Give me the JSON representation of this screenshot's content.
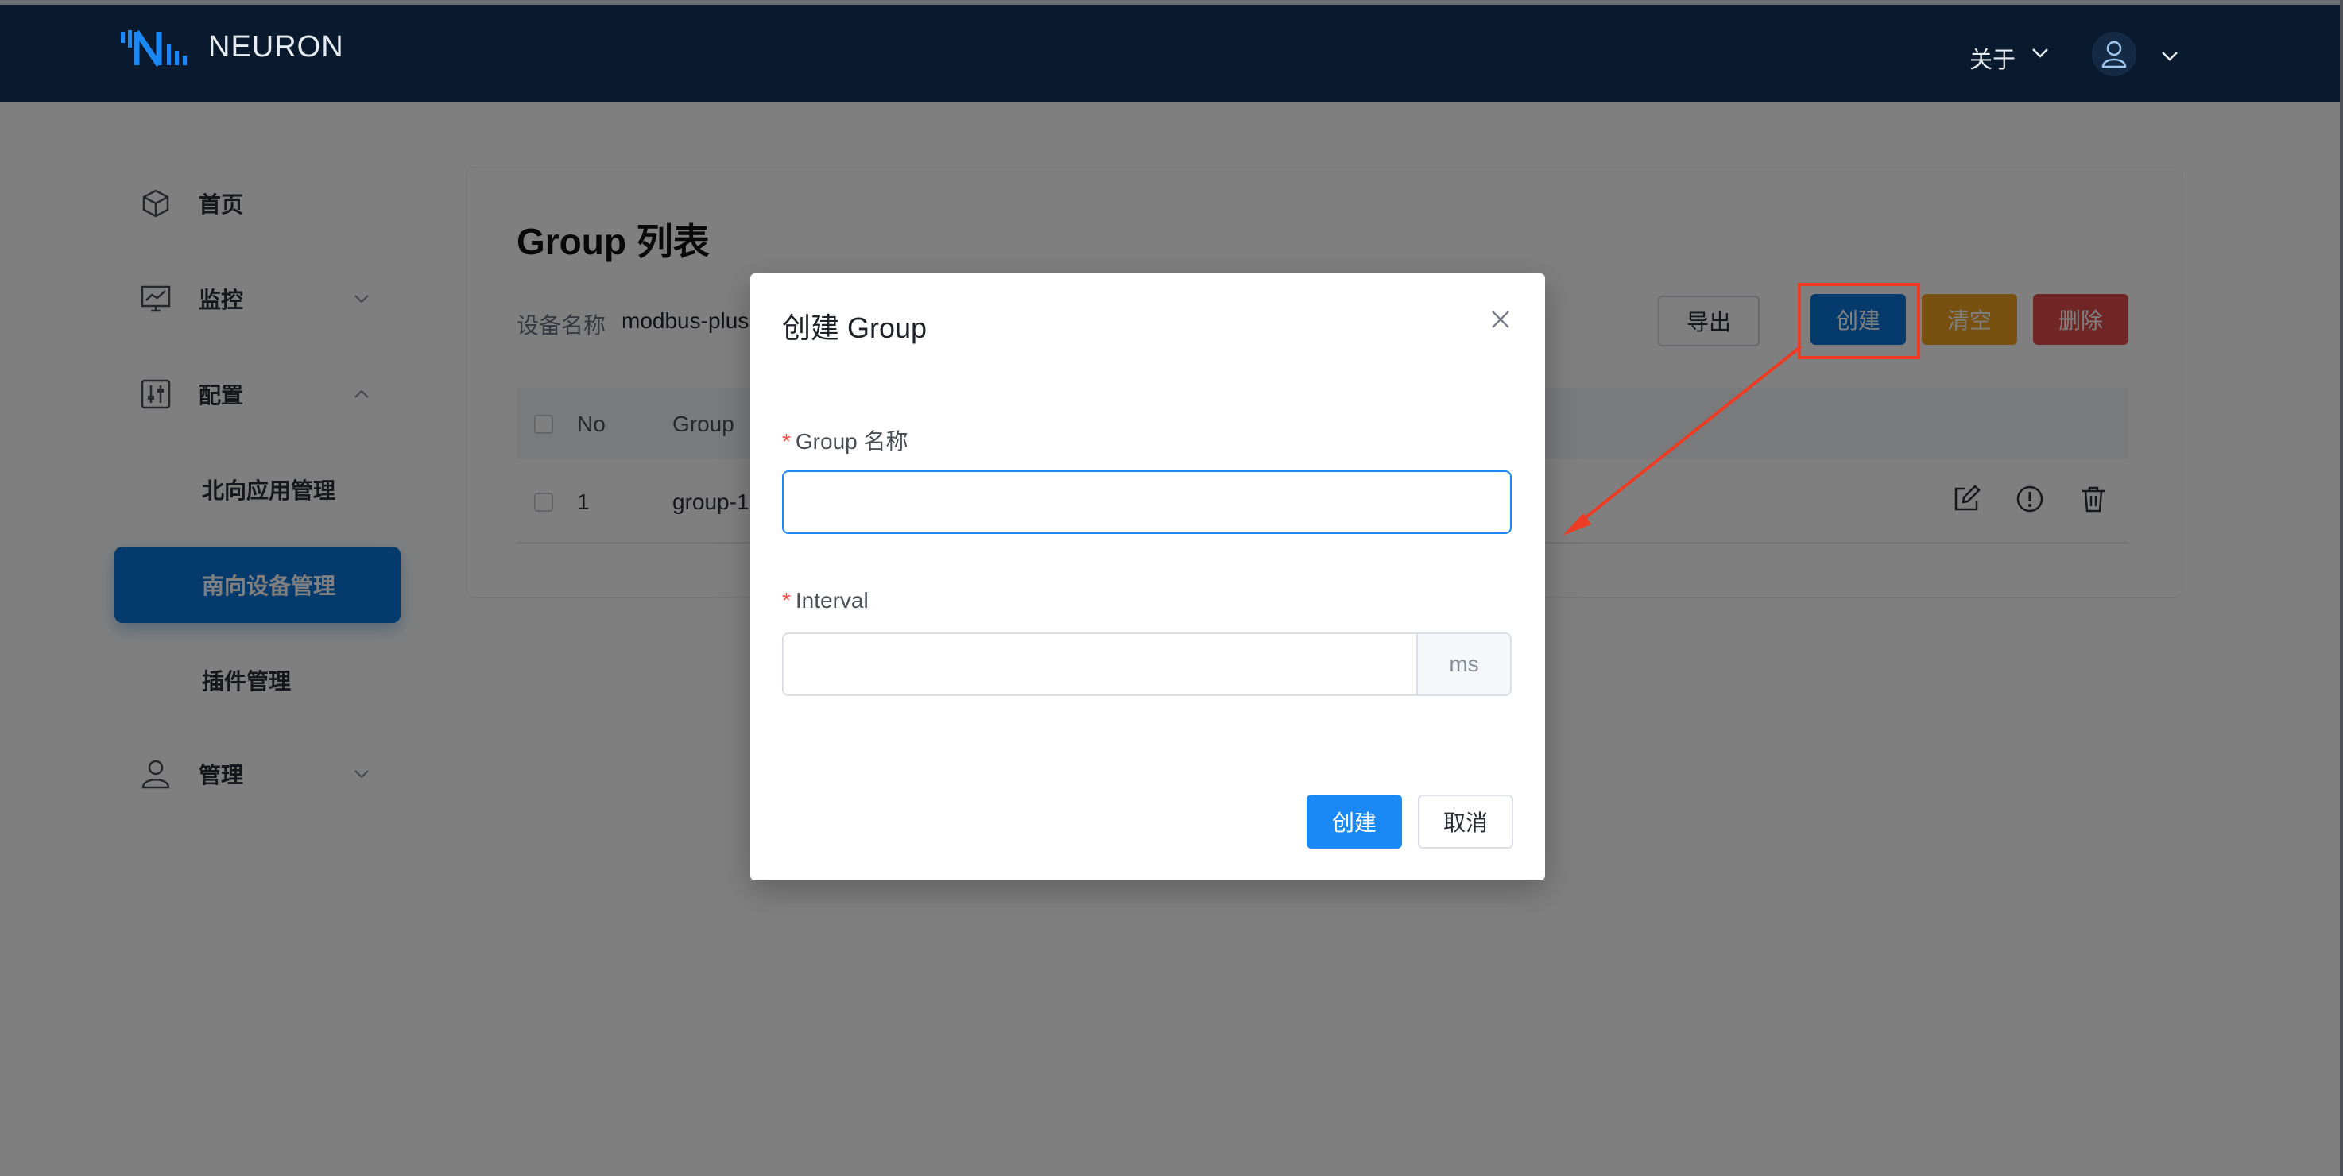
{
  "app": {
    "brand": "NEURON"
  },
  "header": {
    "about_label": "关于"
  },
  "sidebar": {
    "items": [
      {
        "label": "首页",
        "icon": "cube-icon"
      },
      {
        "label": "监控",
        "icon": "monitor-chart-icon"
      },
      {
        "label": "配置",
        "icon": "config-sliders-icon"
      },
      {
        "label": "北向应用管理"
      },
      {
        "label": "南向设备管理",
        "active": true
      },
      {
        "label": "插件管理"
      },
      {
        "label": "管理",
        "icon": "user-icon"
      }
    ]
  },
  "main": {
    "title": "Group 列表",
    "device_label": "设备名称",
    "device_value": "modbus-plus",
    "buttons": {
      "export": "导出",
      "create": "创建",
      "clear": "清空",
      "delete": "删除"
    },
    "table": {
      "headers": [
        "No",
        "Group"
      ],
      "rows": [
        {
          "no": "1",
          "group": "group-1"
        }
      ]
    }
  },
  "modal": {
    "title": "创建 Group",
    "name_label": "Group 名称",
    "name_value": "",
    "interval_label": "Interval",
    "interval_value": "",
    "interval_suffix": "ms",
    "create_label": "创建",
    "cancel_label": "取消",
    "required_mark": "*"
  },
  "colors": {
    "topbar": "#0a1a2e",
    "primary": "#0a74d8",
    "warning": "#f0a020",
    "danger": "#e34d4d",
    "annotation": "#ee3b23"
  }
}
